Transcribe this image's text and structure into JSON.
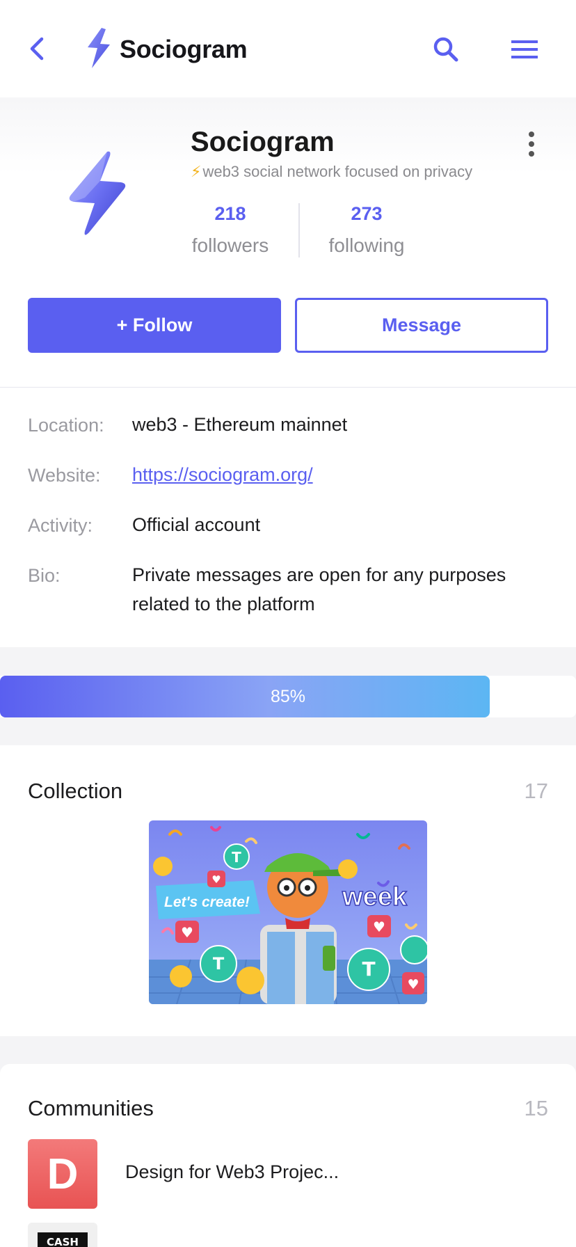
{
  "header": {
    "app_title": "Sociogram",
    "icons": [
      "chevron-left-icon",
      "lightning-logo-icon",
      "search-icon",
      "hamburger-menu-icon"
    ],
    "accent_color": "#5a5ff0"
  },
  "profile": {
    "name": "Sociogram",
    "tagline_emoji": "⚡",
    "tagline": "web3 social network focused on privacy",
    "followers_count": "218",
    "followers_label": "followers",
    "following_count": "273",
    "following_label": "following",
    "follow_label": "+ Follow",
    "message_label": "Message"
  },
  "info": {
    "location_label": "Location:",
    "location_value": "web3 - Ethereum mainnet",
    "website_label": "Website:",
    "website_value": "https://sociogram.org/",
    "activity_label": "Activity:",
    "activity_value": "Official account",
    "bio_label": "Bio:",
    "bio_value": "Private messages are open for any purposes related to the platform"
  },
  "progress": {
    "value": 0.85,
    "label": "85%"
  },
  "collection": {
    "title": "Collection",
    "count": "17",
    "banner_text_left": "Let's create!",
    "banner_text_right": "week"
  },
  "communities": {
    "title": "Communities",
    "count": "15",
    "items": [
      {
        "logo_letter": "D",
        "name": "Design for Web3 Projec..."
      },
      {
        "logo_text": "CASH"
      }
    ]
  }
}
